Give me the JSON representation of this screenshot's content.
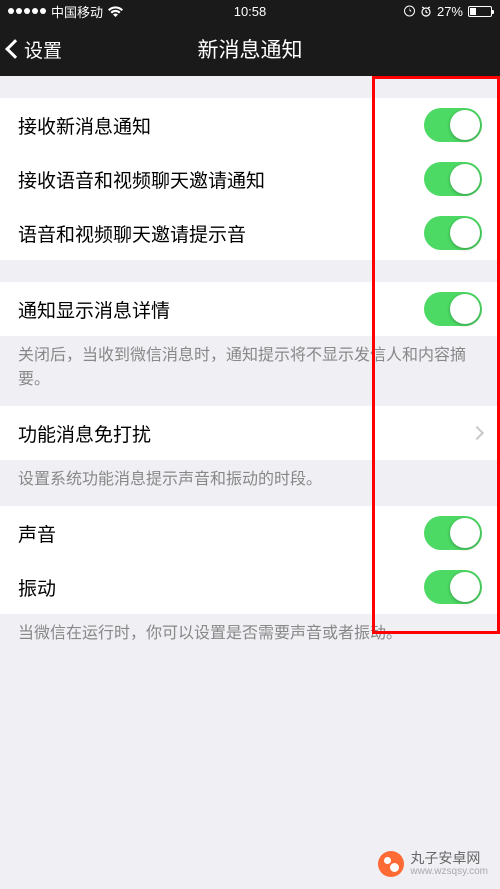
{
  "status": {
    "carrier": "中国移动",
    "time": "10:58",
    "battery_pct": "27%"
  },
  "nav": {
    "back": "设置",
    "title": "新消息通知"
  },
  "groups": [
    {
      "rows": [
        {
          "label": "接收新消息通知",
          "type": "toggle",
          "on": true
        },
        {
          "label": "接收语音和视频聊天邀请通知",
          "type": "toggle",
          "on": true
        },
        {
          "label": "语音和视频聊天邀请提示音",
          "type": "toggle",
          "on": true
        }
      ]
    },
    {
      "rows": [
        {
          "label": "通知显示消息详情",
          "type": "toggle",
          "on": true
        }
      ],
      "footer": "关闭后，当收到微信消息时，通知提示将不显示发信人和内容摘要。"
    },
    {
      "rows": [
        {
          "label": "功能消息免打扰",
          "type": "link"
        }
      ],
      "footer": "设置系统功能消息提示声音和振动的时段。"
    },
    {
      "rows": [
        {
          "label": "声音",
          "type": "toggle",
          "on": true
        },
        {
          "label": "振动",
          "type": "toggle",
          "on": true
        }
      ],
      "footer": "当微信在运行时，你可以设置是否需要声音或者振动。"
    }
  ],
  "watermark": {
    "name": "丸子安卓网",
    "url": "www.wzsqsy.com"
  }
}
